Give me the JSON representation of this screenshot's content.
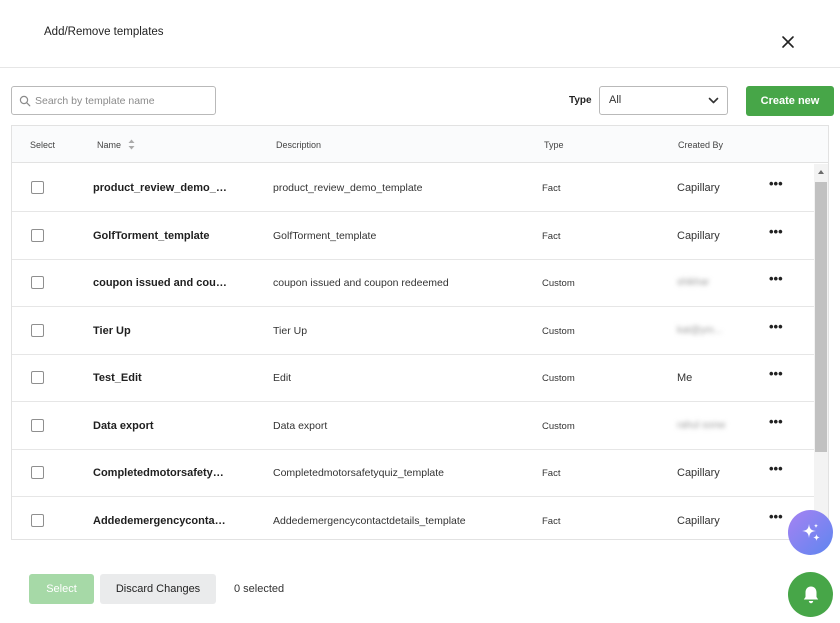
{
  "dialog": {
    "title": "Add/Remove templates"
  },
  "search": {
    "placeholder": "Search by template name",
    "value": ""
  },
  "filter": {
    "type_label": "Type",
    "type_value": "All"
  },
  "toolbar": {
    "create_label": "Create new"
  },
  "table": {
    "columns": {
      "select": "Select",
      "name": "Name",
      "description": "Description",
      "type": "Type",
      "created_by": "Created By"
    },
    "rows": [
      {
        "name": "product_review_demo_te...",
        "description": "product_review_demo_template",
        "type": "Fact",
        "created_by": "Capillary",
        "more": "•••"
      },
      {
        "name": "GolfTorment_template",
        "description": "GolfTorment_template",
        "type": "Fact",
        "created_by": "Capillary",
        "more": "•••"
      },
      {
        "name": "coupon issued and coupo...",
        "description": "coupon issued and coupon redeemed",
        "type": "Custom",
        "created_by": "shikhar",
        "more": "•••"
      },
      {
        "name": "Tier Up",
        "description": "Tier Up",
        "type": "Custom",
        "created_by": "kat@ym...",
        "more": "•••"
      },
      {
        "name": "Test_Edit",
        "description": "Edit",
        "type": "Custom",
        "created_by": "Me",
        "more": "•••"
      },
      {
        "name": "Data export",
        "description": "Data export",
        "type": "Custom",
        "created_by": "rahul sonw",
        "more": "•••"
      },
      {
        "name": "Completedmotorsafetyqui...",
        "description": "Completedmotorsafetyquiz_template",
        "type": "Fact",
        "created_by": "Capillary",
        "more": "•••"
      },
      {
        "name": "Addedemergencycontactd...",
        "description": "Addedemergencycontactdetails_template",
        "type": "Fact",
        "created_by": "Capillary",
        "more": "•••"
      }
    ]
  },
  "footer": {
    "select_label": "Select",
    "discard_label": "Discard Changes",
    "selected_text": "0 selected"
  },
  "icons": {
    "close": "close-icon",
    "search": "search-icon",
    "dropdown": "chevron-down-icon",
    "sort": "sort-icon",
    "more": "more-horizontal-icon",
    "ai": "sparkle-icon",
    "bell": "bell-icon"
  },
  "colors": {
    "primary_green": "#47a648",
    "disabled_green": "#a6d9a7",
    "ai_gradient_start": "#a682f2",
    "ai_gradient_end": "#5e86f0"
  }
}
